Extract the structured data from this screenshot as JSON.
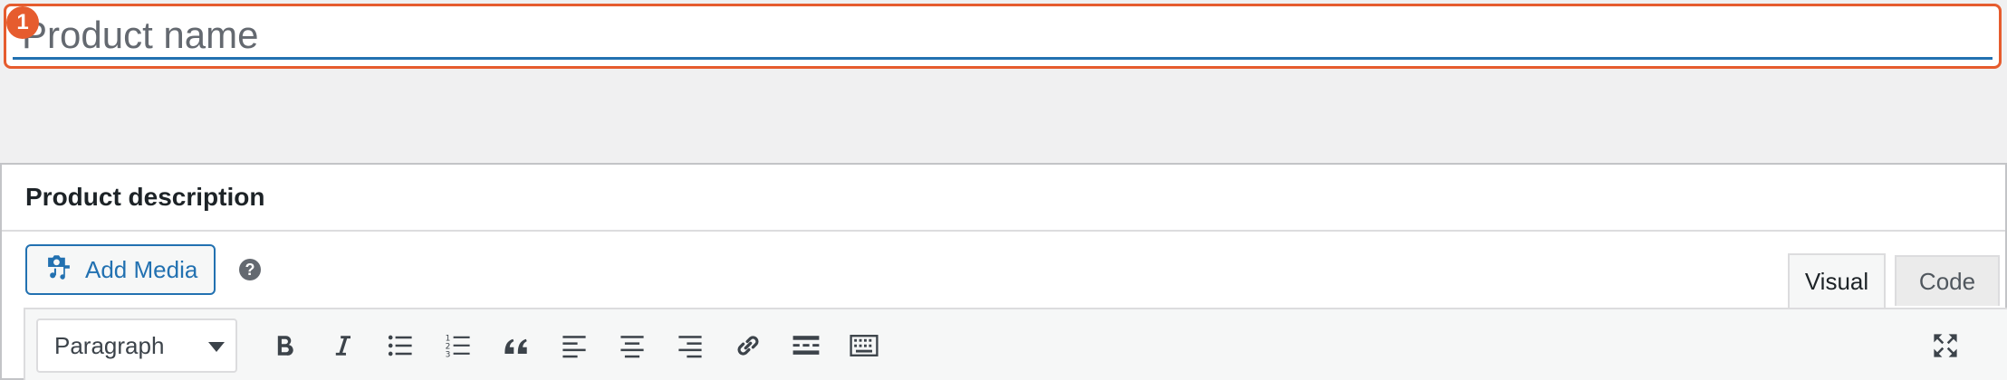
{
  "title": {
    "placeholder": "Product name",
    "step_number": "1"
  },
  "description": {
    "heading": "Product description",
    "add_media_label": "Add Media",
    "help_glyph": "?",
    "tabs": [
      {
        "label": "Visual",
        "active": true
      },
      {
        "label": "Code",
        "active": false
      }
    ],
    "format_select_value": "Paragraph",
    "toolbar_icons": [
      "bold-icon",
      "italic-icon",
      "bulleted-list-icon",
      "numbered-list-icon",
      "blockquote-icon",
      "align-left-icon",
      "align-center-icon",
      "align-right-icon",
      "link-icon",
      "read-more-icon",
      "toolbar-toggle-icon",
      "fullscreen-icon"
    ]
  },
  "colors": {
    "accent": "#2271b1",
    "highlight": "#e65c2e",
    "background": "#f0f0f1"
  }
}
